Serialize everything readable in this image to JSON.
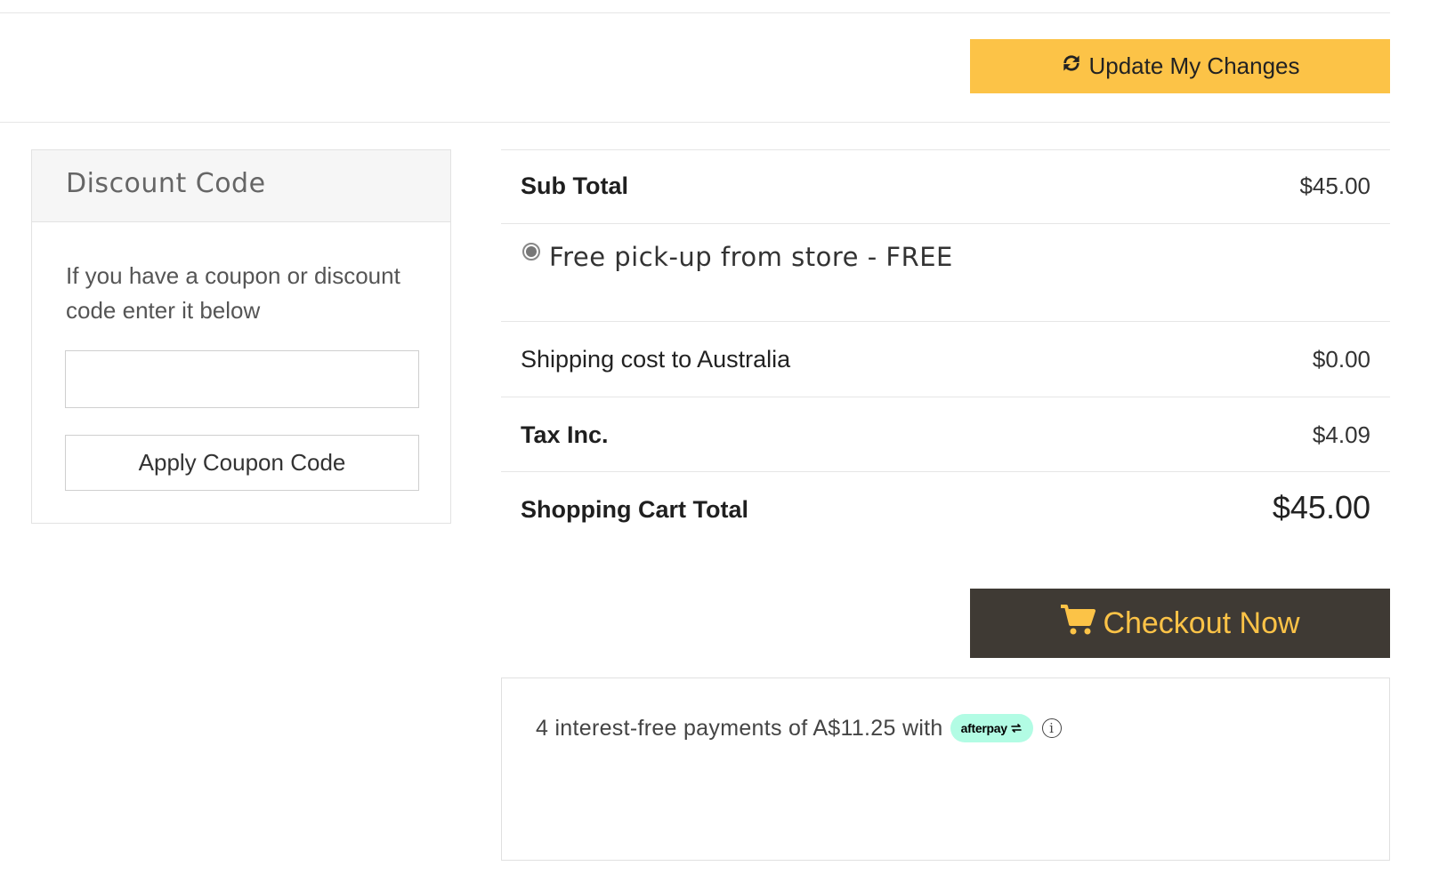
{
  "header": {
    "update_label": "Update My Changes"
  },
  "discount": {
    "title": "Discount Code",
    "description": "If you have a coupon or discount code enter it below",
    "input_value": "",
    "input_placeholder": "",
    "apply_label": "Apply Coupon Code"
  },
  "summary": {
    "subtotal_label": "Sub Total",
    "subtotal_value": "$45.00",
    "shipping_option": "Free pick-up from store - FREE",
    "shipping_label": "Shipping cost to Australia",
    "shipping_value": "$0.00",
    "tax_label": "Tax Inc.",
    "tax_value": "$4.09",
    "total_label": "Shopping Cart Total",
    "total_value": "$45.00"
  },
  "checkout": {
    "label": "Checkout Now"
  },
  "afterpay": {
    "text": "4 interest-free payments of A$11.25 with",
    "badge": "afterpay",
    "info_glyph": "i"
  },
  "colors": {
    "accent_yellow": "#fcc347",
    "checkout_bg": "#3f3a34",
    "afterpay_mint": "#b2fce4"
  },
  "icons": {
    "update": "refresh-icon",
    "checkout": "cart-icon",
    "info": "info-icon",
    "afterpay": "afterpay-logo"
  }
}
